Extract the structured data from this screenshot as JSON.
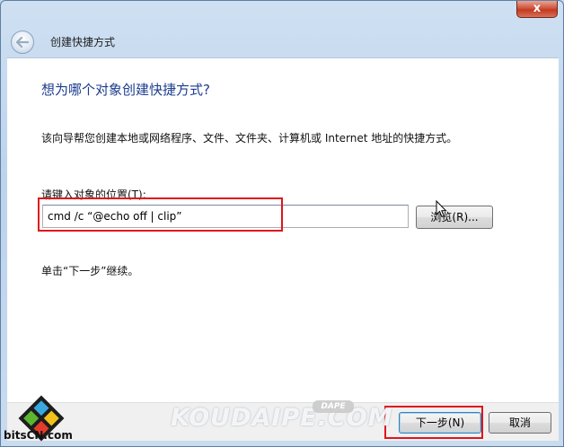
{
  "window": {
    "close_glyph": "x",
    "title": "创建快捷方式"
  },
  "main": {
    "heading": "想为哪个对象创建快捷方式?",
    "description": "该向导帮您创建本地或网络程序、文件、文件夹、计算机或 Internet 地址的快捷方式。",
    "location_label": "请键入对象的位置(T):",
    "location_value": "cmd /c “@echo off | clip”",
    "browse_label": "浏览(R)...",
    "hint": "单击“下一步”继续。"
  },
  "footer": {
    "next_label": "下一步(N)",
    "cancel_label": "取消"
  },
  "branding": {
    "logo_text": "bitsCN.com",
    "watermark_text": "KOUDAIPE.COM",
    "watermark_badge": "DAPE"
  },
  "colors": {
    "heading": "#1c3c8f",
    "highlight": "#e0151b",
    "close_button": "#c23a1f"
  },
  "icons": {
    "back": "back-arrow-icon",
    "close": "close-icon",
    "cursor": "mouse-pointer-icon"
  }
}
